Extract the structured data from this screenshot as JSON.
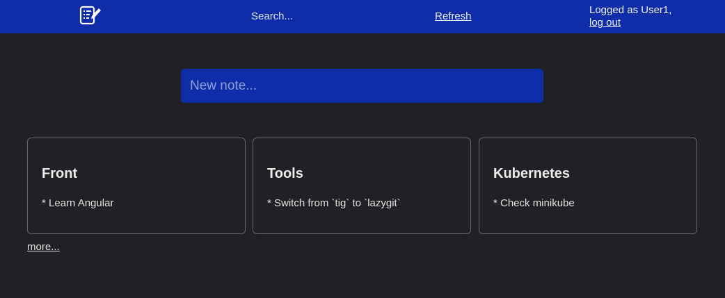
{
  "header": {
    "logo_icon": "note-edit-icon",
    "search_label": "Search...",
    "refresh_label": "Refresh",
    "user_text": "Logged as User1,",
    "logout_label": "log out",
    "bg_color": "#0f2da8"
  },
  "new_note": {
    "placeholder": "New note...",
    "value": ""
  },
  "notes": [
    {
      "title": "Front",
      "body": "* Learn Angular"
    },
    {
      "title": "Tools",
      "body": "* Switch from `tig` to `lazygit`"
    },
    {
      "title": "Kubernetes",
      "body": "* Check minikube"
    }
  ],
  "more_label": "more...",
  "colors": {
    "background": "#202124",
    "accent": "#0f2da8",
    "card_border": "#66686d"
  }
}
